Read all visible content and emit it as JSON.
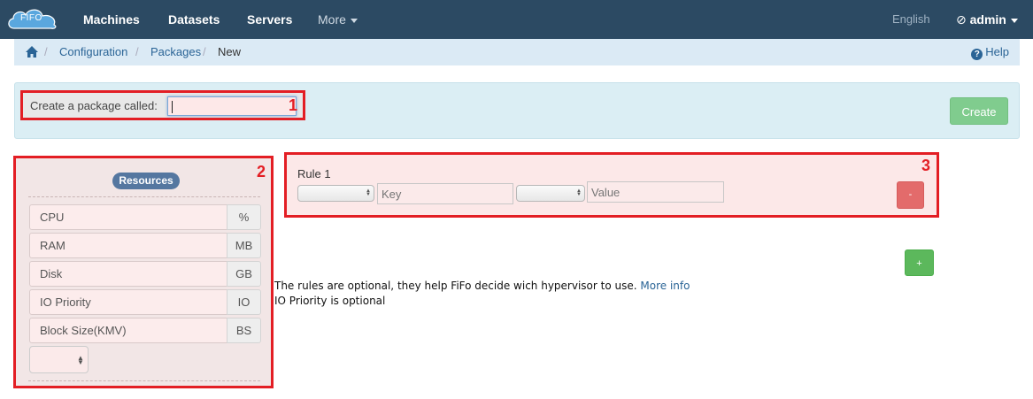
{
  "navbar": {
    "brand": "FIFO",
    "items": [
      "Machines",
      "Datasets",
      "Servers"
    ],
    "more": "More",
    "language": "English",
    "user": "admin"
  },
  "breadcrumb": {
    "items": [
      "Configuration",
      "Packages"
    ],
    "current": "New",
    "help": "Help"
  },
  "form": {
    "name_label": "Create a package called:",
    "name_value": "",
    "create_button": "Create"
  },
  "resources": {
    "title": "Resources",
    "rows": [
      {
        "label": "CPU",
        "unit": "%"
      },
      {
        "label": "RAM",
        "unit": "MB"
      },
      {
        "label": "Disk",
        "unit": "GB"
      },
      {
        "label": "IO Priority",
        "unit": "IO"
      },
      {
        "label": "Block Size(KMV)",
        "unit": "BS"
      }
    ]
  },
  "rules": {
    "label": "Rule 1",
    "key_placeholder": "Key",
    "value_placeholder": "Value",
    "remove_button": "-",
    "add_button": "+"
  },
  "info": {
    "line1": "The rules are optional, they help FiFo decide wich hypervisor to use.",
    "more_info_link": "More info",
    "line2": "IO Priority is optional"
  },
  "annotations": [
    "1",
    "2",
    "3"
  ],
  "colors": {
    "navbar": "#2c4a63",
    "annotation": "#e31e24",
    "create": "#80cc8e",
    "danger": "#e36b6b",
    "success": "#5cb85c"
  }
}
